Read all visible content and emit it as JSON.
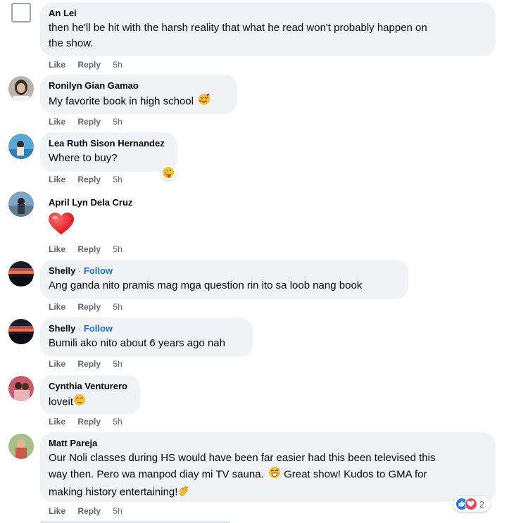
{
  "comments": [
    {
      "name": "An Lei",
      "lines": [
        "then he'll be hit with the harsh reality that what he read won't probably happen on",
        "the show."
      ],
      "actions": {
        "like": "Like",
        "reply": "Reply",
        "time": "5h"
      }
    },
    {
      "name": "Ronilyn Gian Gamao",
      "lines": [
        "My favorite book in high school"
      ],
      "actions": {
        "like": "Like",
        "reply": "Reply",
        "time": "5h"
      }
    },
    {
      "name": "Lea Ruth Sison Hernandez",
      "lines": [
        "Where to buy?"
      ],
      "actions": {
        "like": "Like",
        "reply": "Reply",
        "time": "5h"
      }
    },
    {
      "name": "April Lyn Dela Cruz",
      "lines": [],
      "actions": {
        "like": "Like",
        "reply": "Reply",
        "time": "5h"
      }
    },
    {
      "name": "Shelly",
      "separator": "·",
      "follow": "Follow",
      "lines": [
        "Ang ganda nito pramis mag mga question rin ito sa loob nang book"
      ],
      "actions": {
        "like": "Like",
        "reply": "Reply",
        "time": "5h"
      }
    },
    {
      "name": "Shelly",
      "separator": "·",
      "follow": "Follow",
      "lines": [
        "Bumili ako nito about 6 years ago nah"
      ],
      "actions": {
        "like": "Like",
        "reply": "Reply",
        "time": "5h"
      }
    },
    {
      "name": "Cynthia Venturero",
      "lines": [
        "loveit"
      ],
      "actions": {
        "like": "Like",
        "reply": "Reply",
        "time": "5h"
      }
    },
    {
      "name": "Matt Pareja",
      "lines": [
        "Our Noli classes during HS would have been far easier had this been televised this",
        "way then. Pero wa manpod diay mi TV sauna.",
        " Great show! Kudos to GMA for",
        "making history entertaining!"
      ],
      "actions": {
        "like": "Like",
        "reply": "Reply",
        "time": "5h"
      },
      "reactions": {
        "count": "2",
        "types": [
          "like-icon",
          "love-icon"
        ]
      }
    }
  ],
  "colors": {
    "bubble": "#f0f2f5",
    "meta": "#65676b",
    "follow": "#216fdb",
    "like_blue": "#1877f2",
    "love_red": "#f33e58"
  }
}
